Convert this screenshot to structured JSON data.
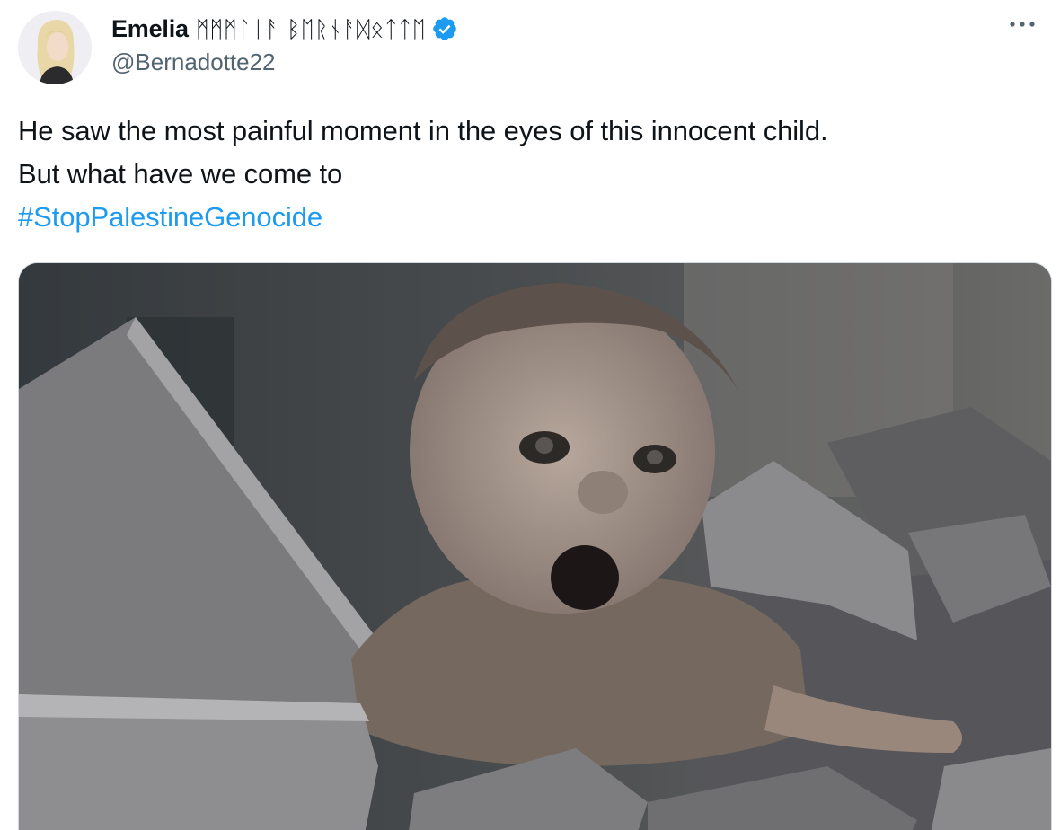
{
  "author": {
    "display_name": "Emelia",
    "display_name_runes": "ᛗᛗᛗᛚᛁᚨ ᛒᛖᚱᚾᚨᛞᛟᛏᛏᛖ",
    "handle": "@Bernadotte22",
    "verified": true,
    "avatar_icon": "profile-photo"
  },
  "menu": {
    "more_icon": "more-horizontal-icon",
    "more_glyph": "···"
  },
  "tweet": {
    "line1": "He saw the most painful moment in the eyes of this innocent child.",
    "line2": "But what have we come to",
    "hashtag": "#StopPalestineGenocide"
  },
  "media": {
    "description_icon": "photo-baby-in-rubble"
  },
  "colors": {
    "accent": "#1d9bf0",
    "secondary_text": "#536471",
    "primary_text": "#0f1419"
  }
}
